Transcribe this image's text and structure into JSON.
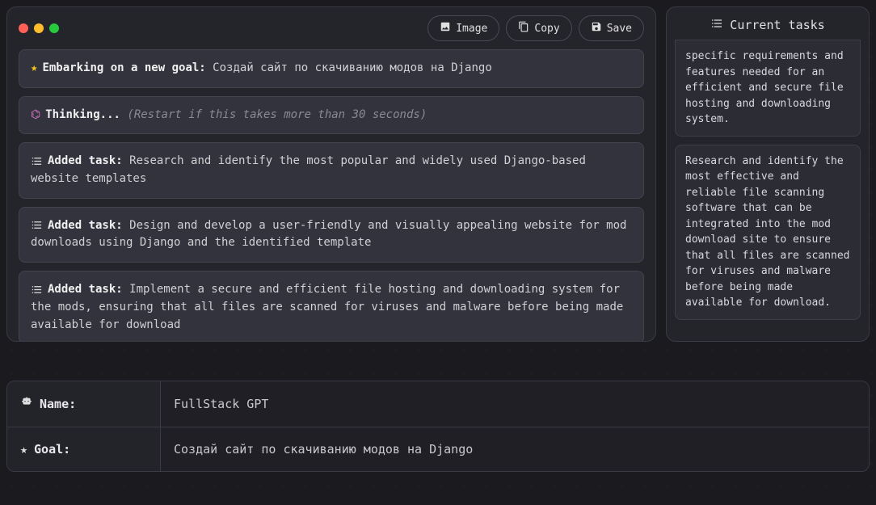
{
  "header": {
    "buttons": {
      "image": "Image",
      "copy": "Copy",
      "save": "Save"
    }
  },
  "feed": {
    "goal_prefix": "Embarking on a new goal:",
    "goal_text": "Создай сайт по скачиванию модов на Django",
    "thinking_prefix": "Thinking...",
    "thinking_hint": "(Restart if this takes more than 30 seconds)",
    "added_task_prefix": "Added task:",
    "task1": "Research and identify the most popular and widely used Django-based website templates",
    "task2": "Design and develop a user-friendly and visually appealing website for mod downloads using Django and the identified template",
    "task3": "Implement a secure and efficient file hosting and downloading system for the mods, ensuring that all files are scanned for viruses and malware before being made available for download"
  },
  "side": {
    "title": "Current tasks",
    "task_partial": "specific requirements and features needed for an efficient and secure file hosting and downloading system.",
    "task_full": "Research and identify the most effective and reliable file scanning software that can be integrated into the mod download site to ensure that all files are scanned for viruses and malware before being made available for download."
  },
  "form": {
    "name_label": "Name:",
    "name_value": "FullStack GPT",
    "goal_label": "Goal:",
    "goal_value": "Создай сайт по скачиванию модов на Django"
  }
}
